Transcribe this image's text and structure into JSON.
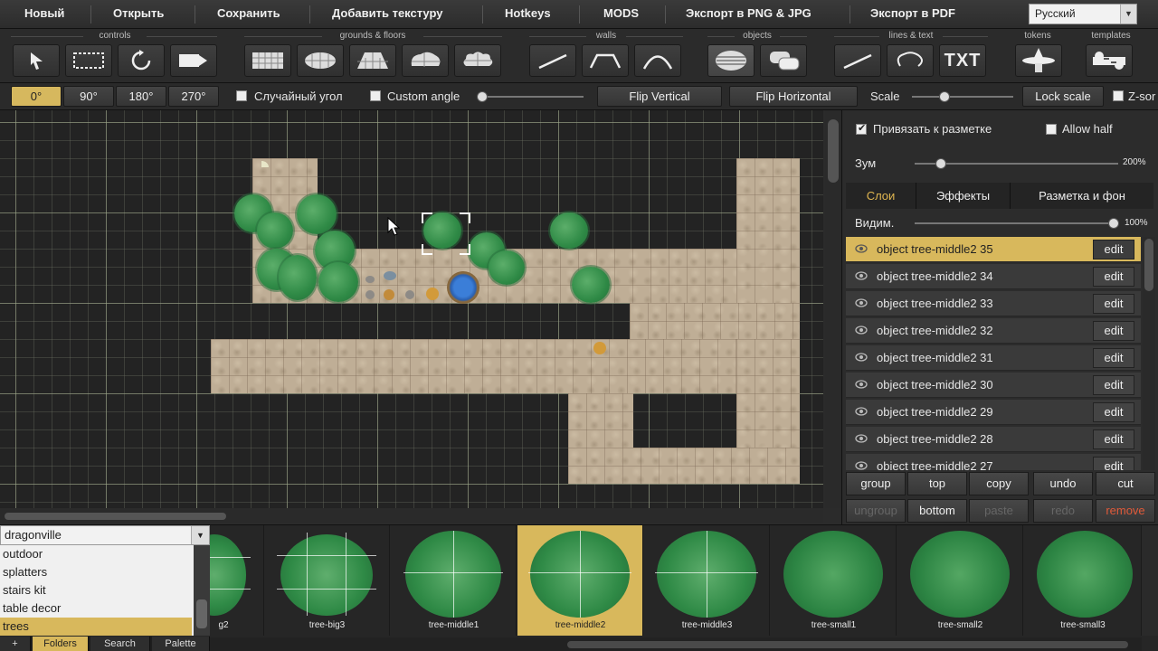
{
  "menu": {
    "items": [
      "Новый",
      "Открыть",
      "Сохранить",
      "Добавить текстуру",
      "Hotkeys",
      "MODS",
      "Экспорт в  PNG & JPG",
      "Экспорт в PDF"
    ],
    "language": "Русский"
  },
  "toolgroups": {
    "controls": "controls",
    "grounds": "grounds & floors",
    "walls": "walls",
    "objects": "objects",
    "lines": "lines & text",
    "tokens": "tokens",
    "templates": "templates",
    "txt_tool": "TXT"
  },
  "options": {
    "angles": [
      "0°",
      "90°",
      "180°",
      "270°"
    ],
    "random_angle": "Случайный угол",
    "custom_angle": "Custom angle",
    "flip_vertical": "Flip Vertical",
    "flip_horizontal": "Flip Horizontal",
    "scale": "Scale",
    "lock_scale": "Lock scale",
    "z_sort": "Z-sor"
  },
  "panel": {
    "snap_label": "Привязать к разметке",
    "allow_half": "Allow half",
    "zoom_label": "Зум",
    "zoom_value": "200%",
    "zoom_level": 0.05,
    "visibility_label": "Видим.",
    "visibility_value": "100%",
    "visibility_level": 1.0,
    "tabs": [
      "Слои",
      "Эффекты",
      "Разметка и фон"
    ],
    "layers": [
      "object tree-middle2 35",
      "object tree-middle2 34",
      "object tree-middle2 33",
      "object tree-middle2 32",
      "object tree-middle2 31",
      "object tree-middle2 30",
      "object tree-middle2 29",
      "object tree-middle2 28",
      "object tree-middle2 27"
    ],
    "edit_label": "edit",
    "actions_row1": [
      "group",
      "top",
      "copy",
      "undo",
      "cut"
    ],
    "actions_row2": [
      "ungroup",
      "bottom",
      "paste",
      "redo",
      "remove"
    ]
  },
  "library": {
    "folder": "dragonville",
    "folders": [
      "outdoor",
      "splatters",
      "stairs kit",
      "table decor",
      "trees"
    ],
    "tabs": [
      "+",
      "Folders",
      "Search",
      "Palette"
    ],
    "thumbnails": [
      "g2",
      "tree-big3",
      "tree-middle1",
      "tree-middle2",
      "tree-middle3",
      "tree-small1",
      "tree-small2",
      "tree-small3"
    ]
  },
  "colors": {
    "accent": "#d8b85c",
    "danger": "#e05a3a",
    "foliage": "#2f8a46"
  }
}
